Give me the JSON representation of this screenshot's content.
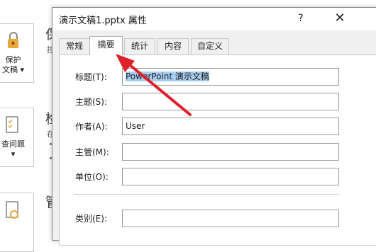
{
  "background": {
    "card_protect": {
      "line1": "保护",
      "line2": "文稿"
    },
    "card_check": {
      "line1": "查问题"
    },
    "heading_initial_1": "保",
    "heading_initial_2": "检",
    "heading_initial_3": "管",
    "sub_initial_1": "控",
    "sub_initial_2": "在"
  },
  "dialog": {
    "title": "演示文稿1.pptx 属性",
    "help": "?",
    "close": "✕",
    "tabs": [
      {
        "label": "常规",
        "active": false
      },
      {
        "label": "摘要",
        "active": true
      },
      {
        "label": "统计",
        "active": false
      },
      {
        "label": "内容",
        "active": false
      },
      {
        "label": "自定义",
        "active": false
      }
    ],
    "fields": [
      {
        "label": "标题(T):",
        "value": "PowerPoint 演示文稿",
        "selected": true
      },
      {
        "label": "主题(S):",
        "value": ""
      },
      {
        "label": "作者(A):",
        "value": "User"
      },
      {
        "label": "主管(M):",
        "value": ""
      },
      {
        "label": "单位(O):",
        "value": ""
      },
      {
        "label": "类别(E):",
        "value": ""
      }
    ]
  },
  "annotation": {
    "arrow_color": "#e0202a"
  },
  "colors": {
    "selection": "#a8cdf0",
    "dialog_bg": "#f0f0f0"
  }
}
